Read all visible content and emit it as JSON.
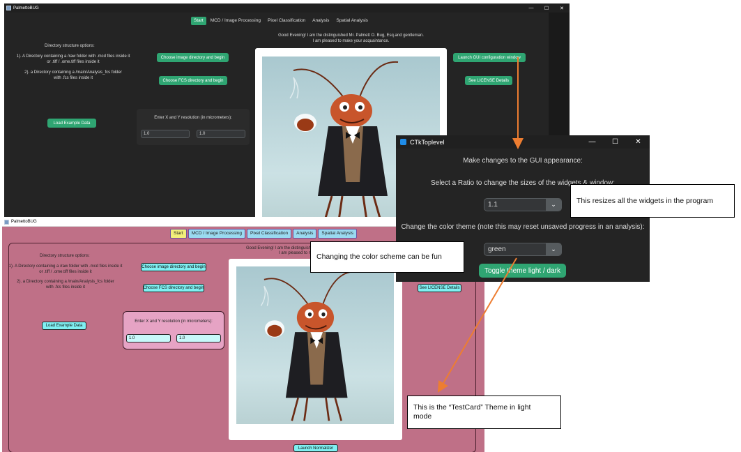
{
  "dark_window": {
    "title": "PalmettoBUG",
    "controls": {
      "minimize": "—",
      "maximize": "☐",
      "close": "✕"
    },
    "tabs": [
      "Start",
      "MCD / Image Processing",
      "Pixel Classification",
      "Analysis",
      "Spatial Analysis"
    ],
    "active_tab": "Start",
    "directory_options_title": "Directory structure options:",
    "option_1_line1": "1). A Directory containing a /raw folder with .mcd files inside it",
    "option_1_line2": "or .tiff / .ome.tiff files inside it",
    "option_2_line1": "2). a Directory containing a /main/Analysis_fcs folder",
    "option_2_line2": "with .fcs files inside it",
    "choose_image_btn": "Choose image directory and begin",
    "choose_fcs_btn": "Choose FCS directory and begin",
    "load_example_btn": "Load Example Data",
    "resolution_label": "Enter X and Y resolution (in micrometers):",
    "x_resolution": "1.0",
    "y_resolution": "1.0",
    "greeting_line1": "Good Evening! I am the distinguished Mr. Palmett O. Bug, Esq.and gentleman.",
    "greeting_line2": "I am pleased to make your acquaintance.",
    "launch_config_btn": "Launch GUI configuration window",
    "license_btn": "See LICENSE Details"
  },
  "light_window": {
    "title": "PalmettoBUG",
    "controls": {
      "minimize": "—",
      "maximize": "☐",
      "close": "✕"
    },
    "tabs": [
      "Start",
      "MCD / Image Processing",
      "Pixel Classification",
      "Analysis",
      "Spatial Analysis"
    ],
    "active_tab": "Start",
    "directory_options_title": "Directory structure options:",
    "option_1_line1": "1). A Directory containing a /raw folder with .mcd files inside it",
    "option_1_line2": "or .tiff / .ome.tiff files inside it",
    "option_2_line1": "2). a Directory containing a /main/Analysis_fcs folder",
    "option_2_line2": "with .fcs files inside it",
    "choose_image_btn": "Choose image directory and begin",
    "choose_fcs_btn": "Choose FCS directory and begin",
    "load_example_btn": "Load Example Data",
    "resolution_label": "Enter X and Y resolution (in micrometers):",
    "x_resolution": "1.0",
    "y_resolution": "1.0",
    "greeting_line1": "Good Evening! I am the distinguishe",
    "greeting_line2": "I am pleased to m",
    "license_btn": "See LICENSE Details",
    "normalizer_btn": "Launch Normalizer"
  },
  "ctk_window": {
    "title": "CTkToplevel",
    "controls": {
      "minimize": "—",
      "maximize": "☐",
      "close": "✕"
    },
    "heading": "Make changes to the GUI appearance:",
    "ratio_label": "Select a Ratio to change the sizes of the widgets & window:",
    "ratio_value": "1.1",
    "theme_label": "Change the color theme (note this may reset unsaved progress in an analysis):",
    "theme_value": "green",
    "toggle_btn": "Toggle theme light / dark",
    "dropdown_arrow": "⌄"
  },
  "callouts": {
    "resize": "This resizes all the widgets in the program",
    "color_scheme": "Changing the color scheme can be fun",
    "testcard_line1": "This is the “TestCard” Theme in light",
    "testcard_line2": "mode"
  },
  "colors": {
    "dark_accent": "#2fa572",
    "light_background": "#bf7087",
    "light_button": "#7ff0f2",
    "arrow": "#ed7d31"
  }
}
